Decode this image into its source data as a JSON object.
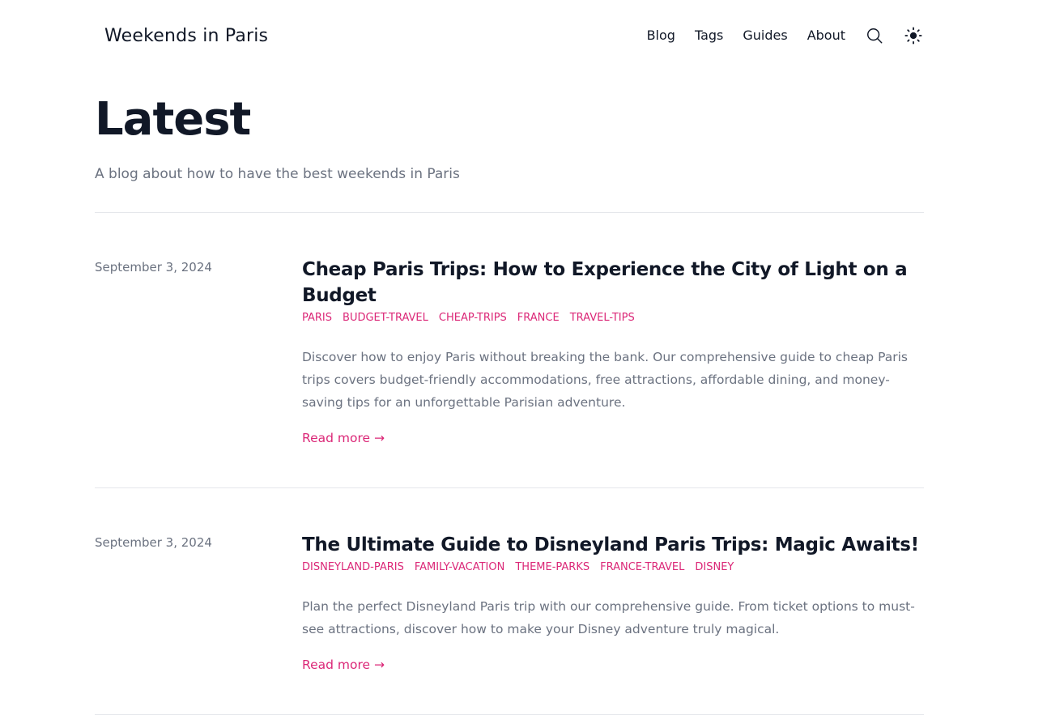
{
  "site": {
    "title": "Weekends in Paris"
  },
  "nav": {
    "items": [
      {
        "label": "Blog"
      },
      {
        "label": "Tags"
      },
      {
        "label": "Guides"
      },
      {
        "label": "About"
      }
    ],
    "search_icon": "search-icon",
    "theme_icon": "sun-icon"
  },
  "hero": {
    "title": "Latest",
    "description": "A blog about how to have the best weekends in Paris"
  },
  "colors": {
    "accent": "#db2777",
    "text": "#111827",
    "muted": "#6b7280",
    "divider": "#e5e7eb"
  },
  "posts": [
    {
      "date": "September 3, 2024",
      "title": "Cheap Paris Trips: How to Experience the City of Light on a Budget",
      "tags": [
        "PARIS",
        "BUDGET-TRAVEL",
        "CHEAP-TRIPS",
        "FRANCE",
        "TRAVEL-TIPS"
      ],
      "excerpt": "Discover how to enjoy Paris without breaking the bank. Our comprehensive guide to cheap Paris trips covers budget-friendly accommodations, free attractions, affordable dining, and money-saving tips for an unforgettable Parisian adventure.",
      "read_more": "Read more →"
    },
    {
      "date": "September 3, 2024",
      "title": "The Ultimate Guide to Disneyland Paris Trips: Magic Awaits!",
      "tags": [
        "DISNEYLAND-PARIS",
        "FAMILY-VACATION",
        "THEME-PARKS",
        "FRANCE-TRAVEL",
        "DISNEY"
      ],
      "excerpt": "Plan the perfect Disneyland Paris trip with our comprehensive guide. From ticket options to must-see attractions, discover how to make your Disney adventure truly magical.",
      "read_more": "Read more →"
    }
  ]
}
